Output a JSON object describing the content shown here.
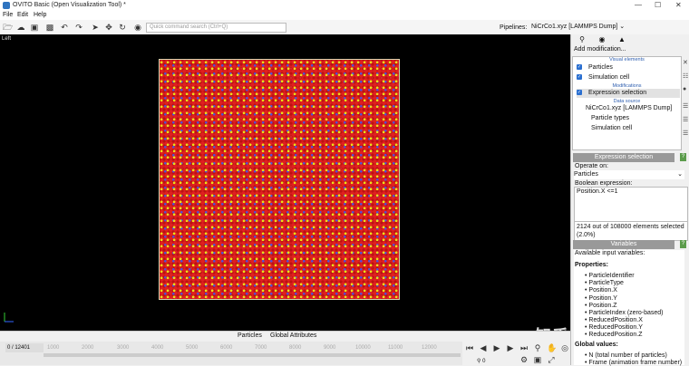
{
  "window": {
    "title": "OVITO Basic (Open Visualization Tool) *"
  },
  "menu": [
    "File",
    "Edit",
    "Help"
  ],
  "toolbar": {
    "search_placeholder": "Quick command search (Ctrl+Q)",
    "pipelines_label": "Pipelines:",
    "pipeline_selected": "NiCrCo1.xyz [LAMMPS Dump]"
  },
  "viewport": {
    "label": "Left"
  },
  "bottom_tabs": [
    "Particles",
    "Global Attributes"
  ],
  "timeline": {
    "frame_readout": "0 / 12401",
    "ticks": [
      "1000",
      "2000",
      "3000",
      "4000",
      "5000",
      "6000",
      "7000",
      "8000",
      "9000",
      "10000",
      "11000",
      "12000"
    ],
    "spinner_value": "0"
  },
  "pipeline_panel": {
    "add_modification": "Add modification...",
    "section_visual": "Visual elements",
    "visual_items": [
      {
        "label": "Particles",
        "checked": true
      },
      {
        "label": "Simulation cell",
        "checked": true
      }
    ],
    "section_modifications": "Modifications",
    "modification_items": [
      {
        "label": "Expression selection",
        "checked": true
      }
    ],
    "section_data_source": "Data source",
    "data_source": "NiCrCo1.xyz [LAMMPS Dump]",
    "data_items": [
      "Particle types",
      "Simulation cell"
    ]
  },
  "expression_selection": {
    "header": "Expression selection",
    "operate_on_label": "Operate on:",
    "operate_on_value": "Particles",
    "boolean_label": "Boolean expression:",
    "expression": "Position.X <=1",
    "result_line1": "2124 out of 108000 elements selected",
    "result_line2": "(2.0%)"
  },
  "variables": {
    "header": "Variables",
    "available_label": "Available input variables:",
    "properties_label": "Properties:",
    "items": [
      "ParticleIdentifier",
      "ParticleType",
      "Position.X",
      "Position.Y",
      "Position.Z",
      "ParticleIndex (zero-based)",
      "ReducedPosition.X",
      "ReducedPosition.Y",
      "ReducedPosition.Z"
    ],
    "global_label": "Global values:",
    "global_items": [
      "N (total number of particles)",
      "Frame (animation frame number)"
    ]
  },
  "watermark": "知乎 @KAE320",
  "colors": {
    "particles_main": "#c81414",
    "particles_accent_yellow": "#e8e21a",
    "particles_accent_blue": "#5050d8",
    "selection_blue": "#2a6fd0",
    "panel_header": "#999999"
  }
}
